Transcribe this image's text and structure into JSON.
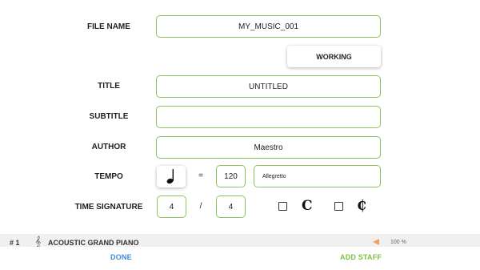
{
  "form": {
    "file_name": {
      "label": "FILE NAME",
      "value": "MY_MUSIC_001"
    },
    "status_button": "WORKING",
    "title": {
      "label": "TITLE",
      "value": "UNTITLED"
    },
    "subtitle": {
      "label": "SUBTITLE",
      "value": ""
    },
    "author": {
      "label": "AUTHOR",
      "value": "Maestro"
    },
    "tempo": {
      "label": "TEMPO",
      "note_icon": "quarter-note-icon",
      "equals": "=",
      "bpm": "120",
      "marking": "Allegretto"
    },
    "time_signature": {
      "label": "TIME SIGNATURE",
      "numerator": "4",
      "slash": "/",
      "denominator": "4",
      "common_time_symbol": "C",
      "cut_time_symbol": "₵"
    }
  },
  "staff_list": {
    "row": {
      "number": "# 1",
      "instrument": "ACOUSTIC GRAND PIANO",
      "right_text": "100 %"
    }
  },
  "footer": {
    "done_label": "DONE",
    "add_staff_label": "ADD STAFF"
  },
  "colors": {
    "accent_green": "#8cc55f",
    "done_blue": "#3d8bd6",
    "add_staff_green": "#7cc242"
  }
}
